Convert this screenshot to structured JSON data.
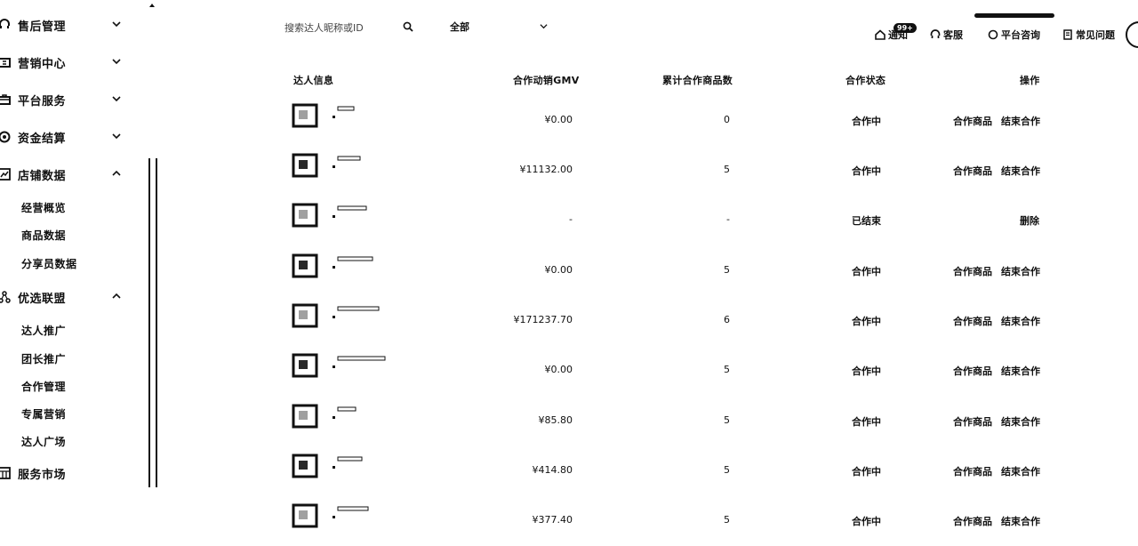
{
  "sidebar": {
    "groups": [
      {
        "label": "售后管理",
        "icon": "headset-icon",
        "expanded": false
      },
      {
        "label": "营销中心",
        "icon": "ticket-icon",
        "expanded": false
      },
      {
        "label": "平台服务",
        "icon": "briefcase-icon",
        "expanded": false
      },
      {
        "label": "资金结算",
        "icon": "coin-icon",
        "expanded": false
      },
      {
        "label": "店铺数据",
        "icon": "chart-icon",
        "expanded": true,
        "children": [
          "经营概览",
          "商品数据",
          "分享员数据"
        ]
      },
      {
        "label": "优选联盟",
        "icon": "network-icon",
        "expanded": true,
        "children": [
          "达人推广",
          "团长推广",
          "合作管理",
          "专属营销",
          "达人广场"
        ]
      },
      {
        "label": "服务市场",
        "icon": "store-icon",
        "expanded": false
      }
    ]
  },
  "search": {
    "placeholder": "搜索达人昵称或ID"
  },
  "filter": {
    "selected": "全部"
  },
  "header": {
    "notice_label": "通知",
    "notice_badge": "99+",
    "service_label": "客服",
    "consult_label": "平台咨询",
    "faq_label": "常见问题"
  },
  "table": {
    "columns": [
      "达人信息",
      "合作动销GMV",
      "累计合作商品数",
      "合作状态",
      "操作"
    ],
    "rows": [
      {
        "gmv": "¥0.00",
        "count": "0",
        "status": "合作中",
        "actions": [
          "合作商品",
          "结束合作"
        ]
      },
      {
        "gmv": "¥11132.00",
        "count": "5",
        "status": "合作中",
        "actions": [
          "合作商品",
          "结束合作"
        ]
      },
      {
        "gmv": "-",
        "count": "-",
        "status": "已结束",
        "actions": [
          "删除"
        ]
      },
      {
        "gmv": "¥0.00",
        "count": "5",
        "status": "合作中",
        "actions": [
          "合作商品",
          "结束合作"
        ]
      },
      {
        "gmv": "¥171237.70",
        "count": "6",
        "status": "合作中",
        "actions": [
          "合作商品",
          "结束合作"
        ]
      },
      {
        "gmv": "¥0.00",
        "count": "5",
        "status": "合作中",
        "actions": [
          "合作商品",
          "结束合作"
        ]
      },
      {
        "gmv": "¥85.80",
        "count": "5",
        "status": "合作中",
        "actions": [
          "合作商品",
          "结束合作"
        ]
      },
      {
        "gmv": "¥414.80",
        "count": "5",
        "status": "合作中",
        "actions": [
          "合作商品",
          "结束合作"
        ]
      },
      {
        "gmv": "¥377.40",
        "count": "5",
        "status": "合作中",
        "actions": [
          "合作商品",
          "结束合作"
        ]
      }
    ]
  }
}
